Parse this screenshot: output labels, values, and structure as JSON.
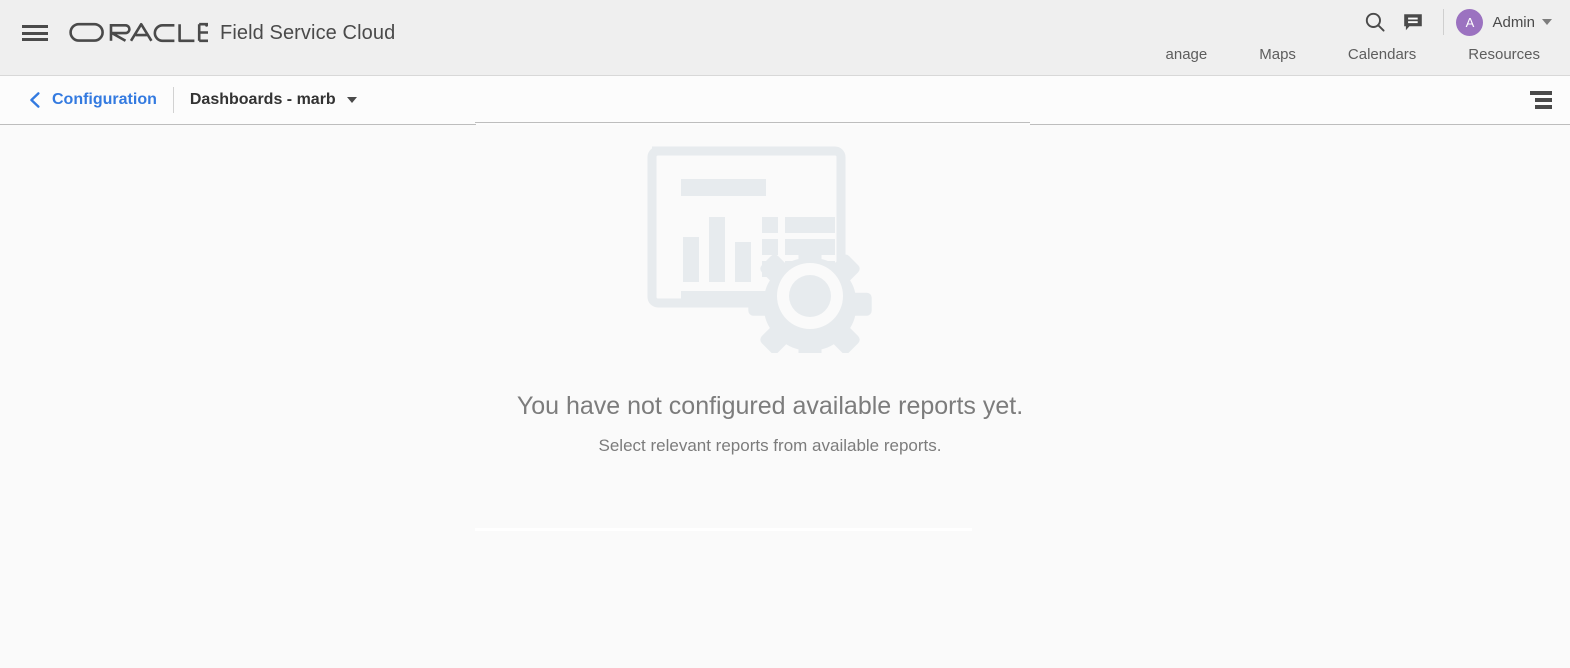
{
  "header": {
    "menu_icon": "hamburger-menu-icon",
    "brand": "ORACLE",
    "product": "Field Service Cloud",
    "search_icon": "search-icon",
    "messages_icon": "chat-bubble-icon",
    "user": {
      "avatar_initial": "A",
      "name": "Admin",
      "avatar_color": "#9b72c0",
      "caret_icon": "chevron-down-icon"
    },
    "nav_links": [
      {
        "label": "anage"
      },
      {
        "label": "Maps"
      },
      {
        "label": "Calendars"
      },
      {
        "label": "Resources"
      }
    ]
  },
  "subbar": {
    "back_icon": "chevron-left-icon",
    "breadcrumb_link": "Configuration",
    "current_title": "Dashboards - marb",
    "title_caret_icon": "chevron-down-icon",
    "panel_menu_icon": "list-menu-icon"
  },
  "empty_state": {
    "illustration": "report-with-gear-icon",
    "title": "You have not configured available reports yet.",
    "subtitle": "Select relevant reports from available reports."
  },
  "colors": {
    "header_bg": "#efefef",
    "body_bg": "#fafafa",
    "link_blue": "#337ae0",
    "text_gray": "#7c7c7c",
    "illustration_gray": "#e7ebee"
  }
}
